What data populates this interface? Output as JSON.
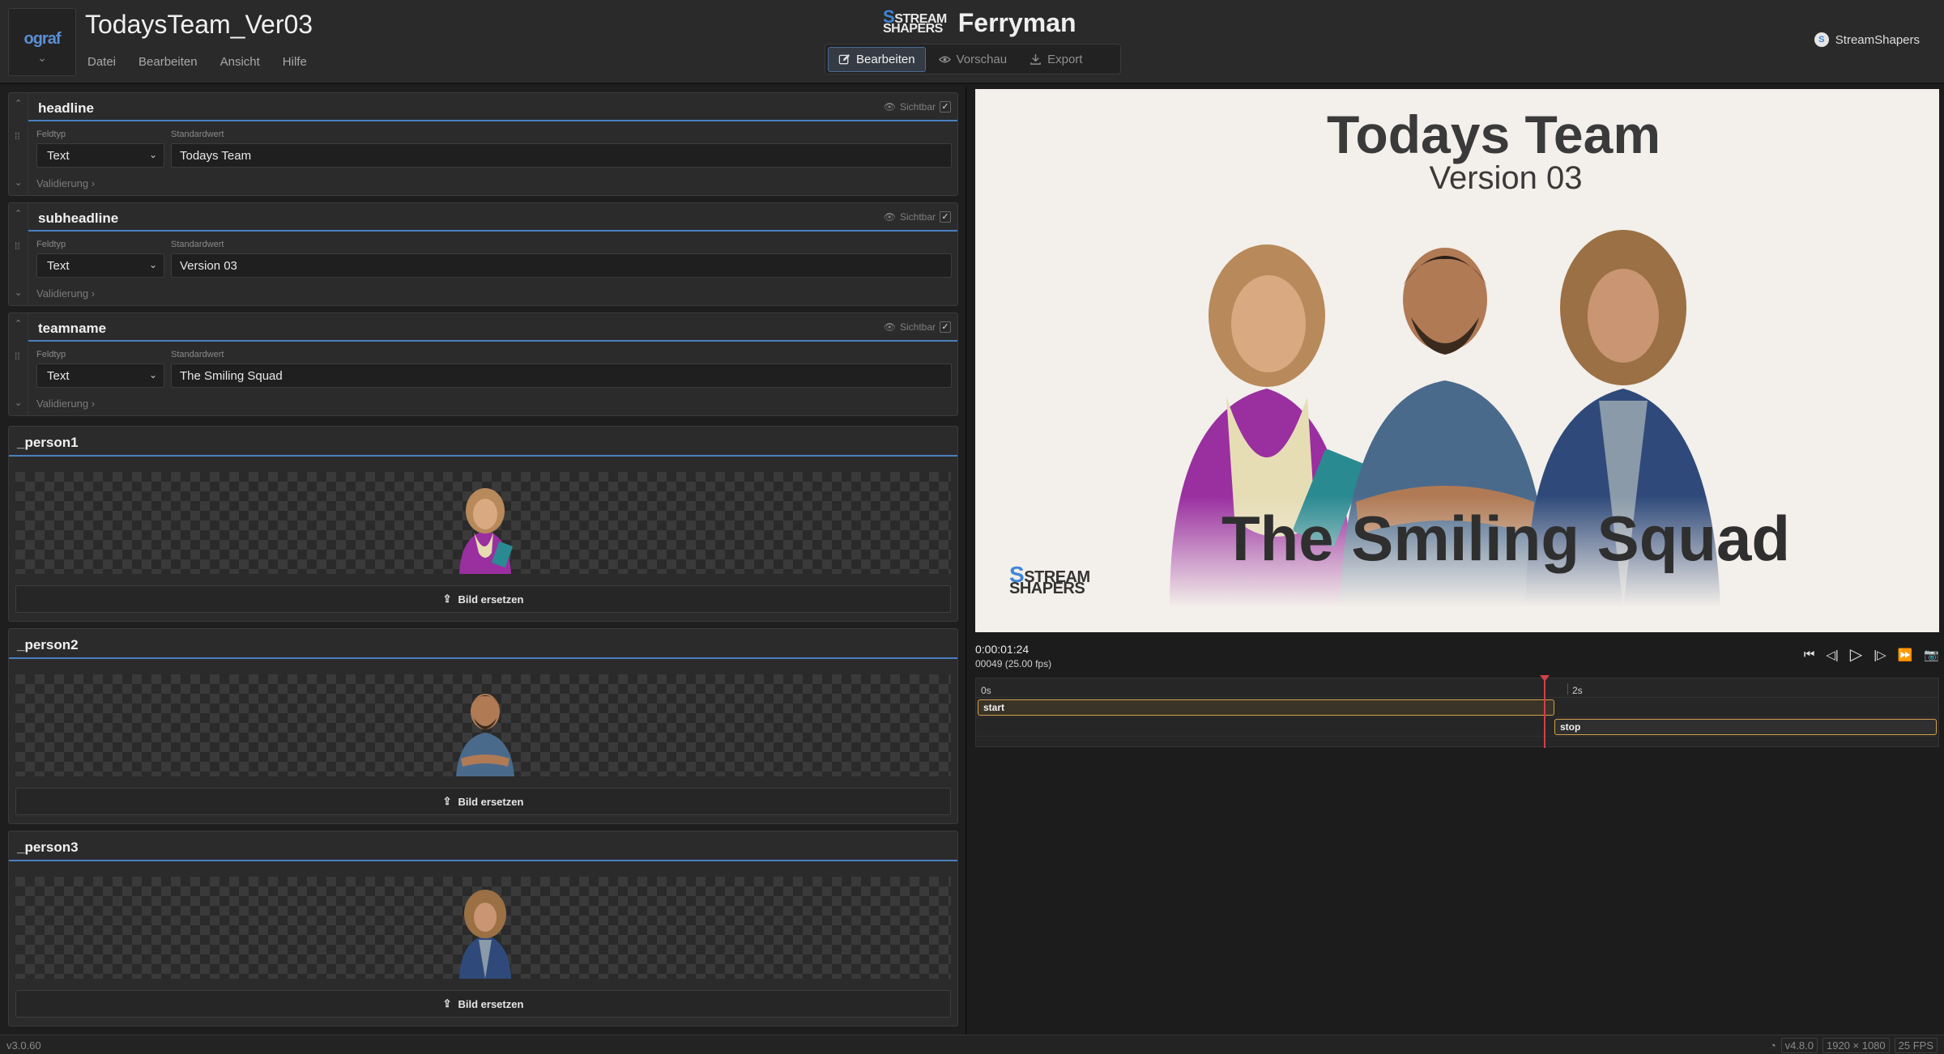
{
  "app": {
    "document_title": "TodaysTeam_Ver03",
    "logo_text": "ograf",
    "menu": [
      "Datei",
      "Bearbeiten",
      "Ansicht",
      "Hilfe"
    ],
    "brand_logo_line1": "STREAM",
    "brand_logo_line2": "SHAPERS",
    "brand_name": "Ferryman",
    "modes": [
      {
        "label": "Bearbeiten",
        "active": true,
        "icon": "edit-icon"
      },
      {
        "label": "Vorschau",
        "active": false,
        "icon": "eye-icon"
      },
      {
        "label": "Export",
        "active": false,
        "icon": "download-icon"
      }
    ],
    "account": "StreamShapers"
  },
  "fields": [
    {
      "name": "headline",
      "visible_label": "Sichtbar",
      "type_label": "Feldtyp",
      "default_label": "Standardwert",
      "type": "Text",
      "value": "Todays Team",
      "validation": "Validierung"
    },
    {
      "name": "subheadline",
      "visible_label": "Sichtbar",
      "type_label": "Feldtyp",
      "default_label": "Standardwert",
      "type": "Text",
      "value": "Version 03",
      "validation": "Validierung"
    },
    {
      "name": "teamname",
      "visible_label": "Sichtbar",
      "type_label": "Feldtyp",
      "default_label": "Standardwert",
      "type": "Text",
      "value": "The Smiling Squad",
      "validation": "Validierung"
    }
  ],
  "image_fields": [
    {
      "name": "_person1",
      "button": "Bild ersetzen"
    },
    {
      "name": "_person2",
      "button": "Bild ersetzen"
    },
    {
      "name": "_person3",
      "button": "Bild ersetzen"
    }
  ],
  "preview": {
    "title": "Todays Team",
    "subtitle": "Version 03",
    "team": "The Smiling Squad",
    "logo_line1": "STREAM",
    "logo_line2": "SHAPERS"
  },
  "playback": {
    "timecode": "0:00:01:24",
    "frames": "00049 (25.00 fps)"
  },
  "timeline": {
    "ruler": [
      "0s",
      "2s"
    ],
    "clips": [
      "start",
      "stop"
    ]
  },
  "statusbar": {
    "version": "v3.0.60",
    "engine": "v4.8.0",
    "resolution": "1920 × 1080",
    "fps": "25 FPS"
  },
  "colors": {
    "accent": "#4a7fc0",
    "clip_border": "#d0a04a",
    "playhead": "#d0414a",
    "person1_top": "#9a2fa0",
    "person2_top": "#4a6a8c",
    "person3_top": "#2f4a7a"
  }
}
